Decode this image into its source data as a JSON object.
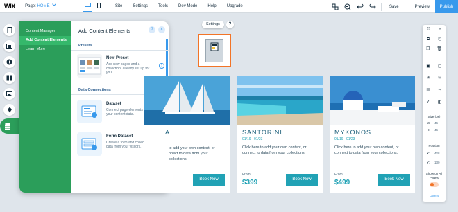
{
  "topbar": {
    "logo": "WIX",
    "page_label": "Page:",
    "page_value": "HOME",
    "menu": [
      "Site",
      "Settings",
      "Tools",
      "Dev Mode",
      "Help",
      "Upgrade"
    ],
    "save": "Save",
    "preview": "Preview",
    "publish": "Publish"
  },
  "left_tools": [
    "pages-icon",
    "background-icon",
    "add-icon",
    "apps-icon",
    "media-icon",
    "pen-icon",
    "database-icon"
  ],
  "add_panel": {
    "nav": [
      "Content Manager",
      "Add Content Elements",
      "Learn More"
    ],
    "selected_nav": "Add Content Elements",
    "title": "Add Content Elements",
    "help": "?",
    "close": "×",
    "sections": [
      {
        "heading": "Presets",
        "items": [
          {
            "name": "New Preset",
            "desc": "Add new pages and a collection, already set up for you."
          }
        ]
      },
      {
        "heading": "Data Connections",
        "items": [
          {
            "name": "Dataset",
            "desc": "Connect page elements to your content data."
          },
          {
            "name": "Form Dataset",
            "desc": "Create a form and collect data from your visitors."
          }
        ]
      }
    ]
  },
  "canvas": {
    "settings": "Settings",
    "help": "?",
    "selected_element": {
      "label": "Dataset",
      "caption": "Dataset"
    },
    "cards": [
      {
        "name": "A",
        "date": "",
        "desc": "to add your own content, or nnect to data from your collections.",
        "from": "",
        "price": "",
        "book": "Book Now"
      },
      {
        "name": "SANTORINI",
        "date": "01/19 - 01/23",
        "desc": "Click here to add your own content, or connect to data from your collections.",
        "from": "From",
        "price": "$399",
        "book": "Book Now"
      },
      {
        "name": "MYKONOS",
        "date": "01/19 - 01/23",
        "desc": "Click here to add your own content, or connect to data from your collections.",
        "from": "From",
        "price": "$499",
        "book": "Book Now"
      }
    ]
  },
  "right_panel": {
    "size_label": "Size (px)",
    "w_key": "W:",
    "w_val": "46",
    "h_key": "H:",
    "h_val": "46",
    "pos_label": "Position",
    "x_key": "X:",
    "x_val": "428",
    "y_key": "Y:",
    "y_val": "130",
    "show_all": "Show on All Pages",
    "layers": "Layers"
  },
  "colors": {
    "accent": "#3899ec",
    "panel_green": "#2b9e5a",
    "card_teal": "#21a2b5",
    "selection": "#f27427"
  }
}
